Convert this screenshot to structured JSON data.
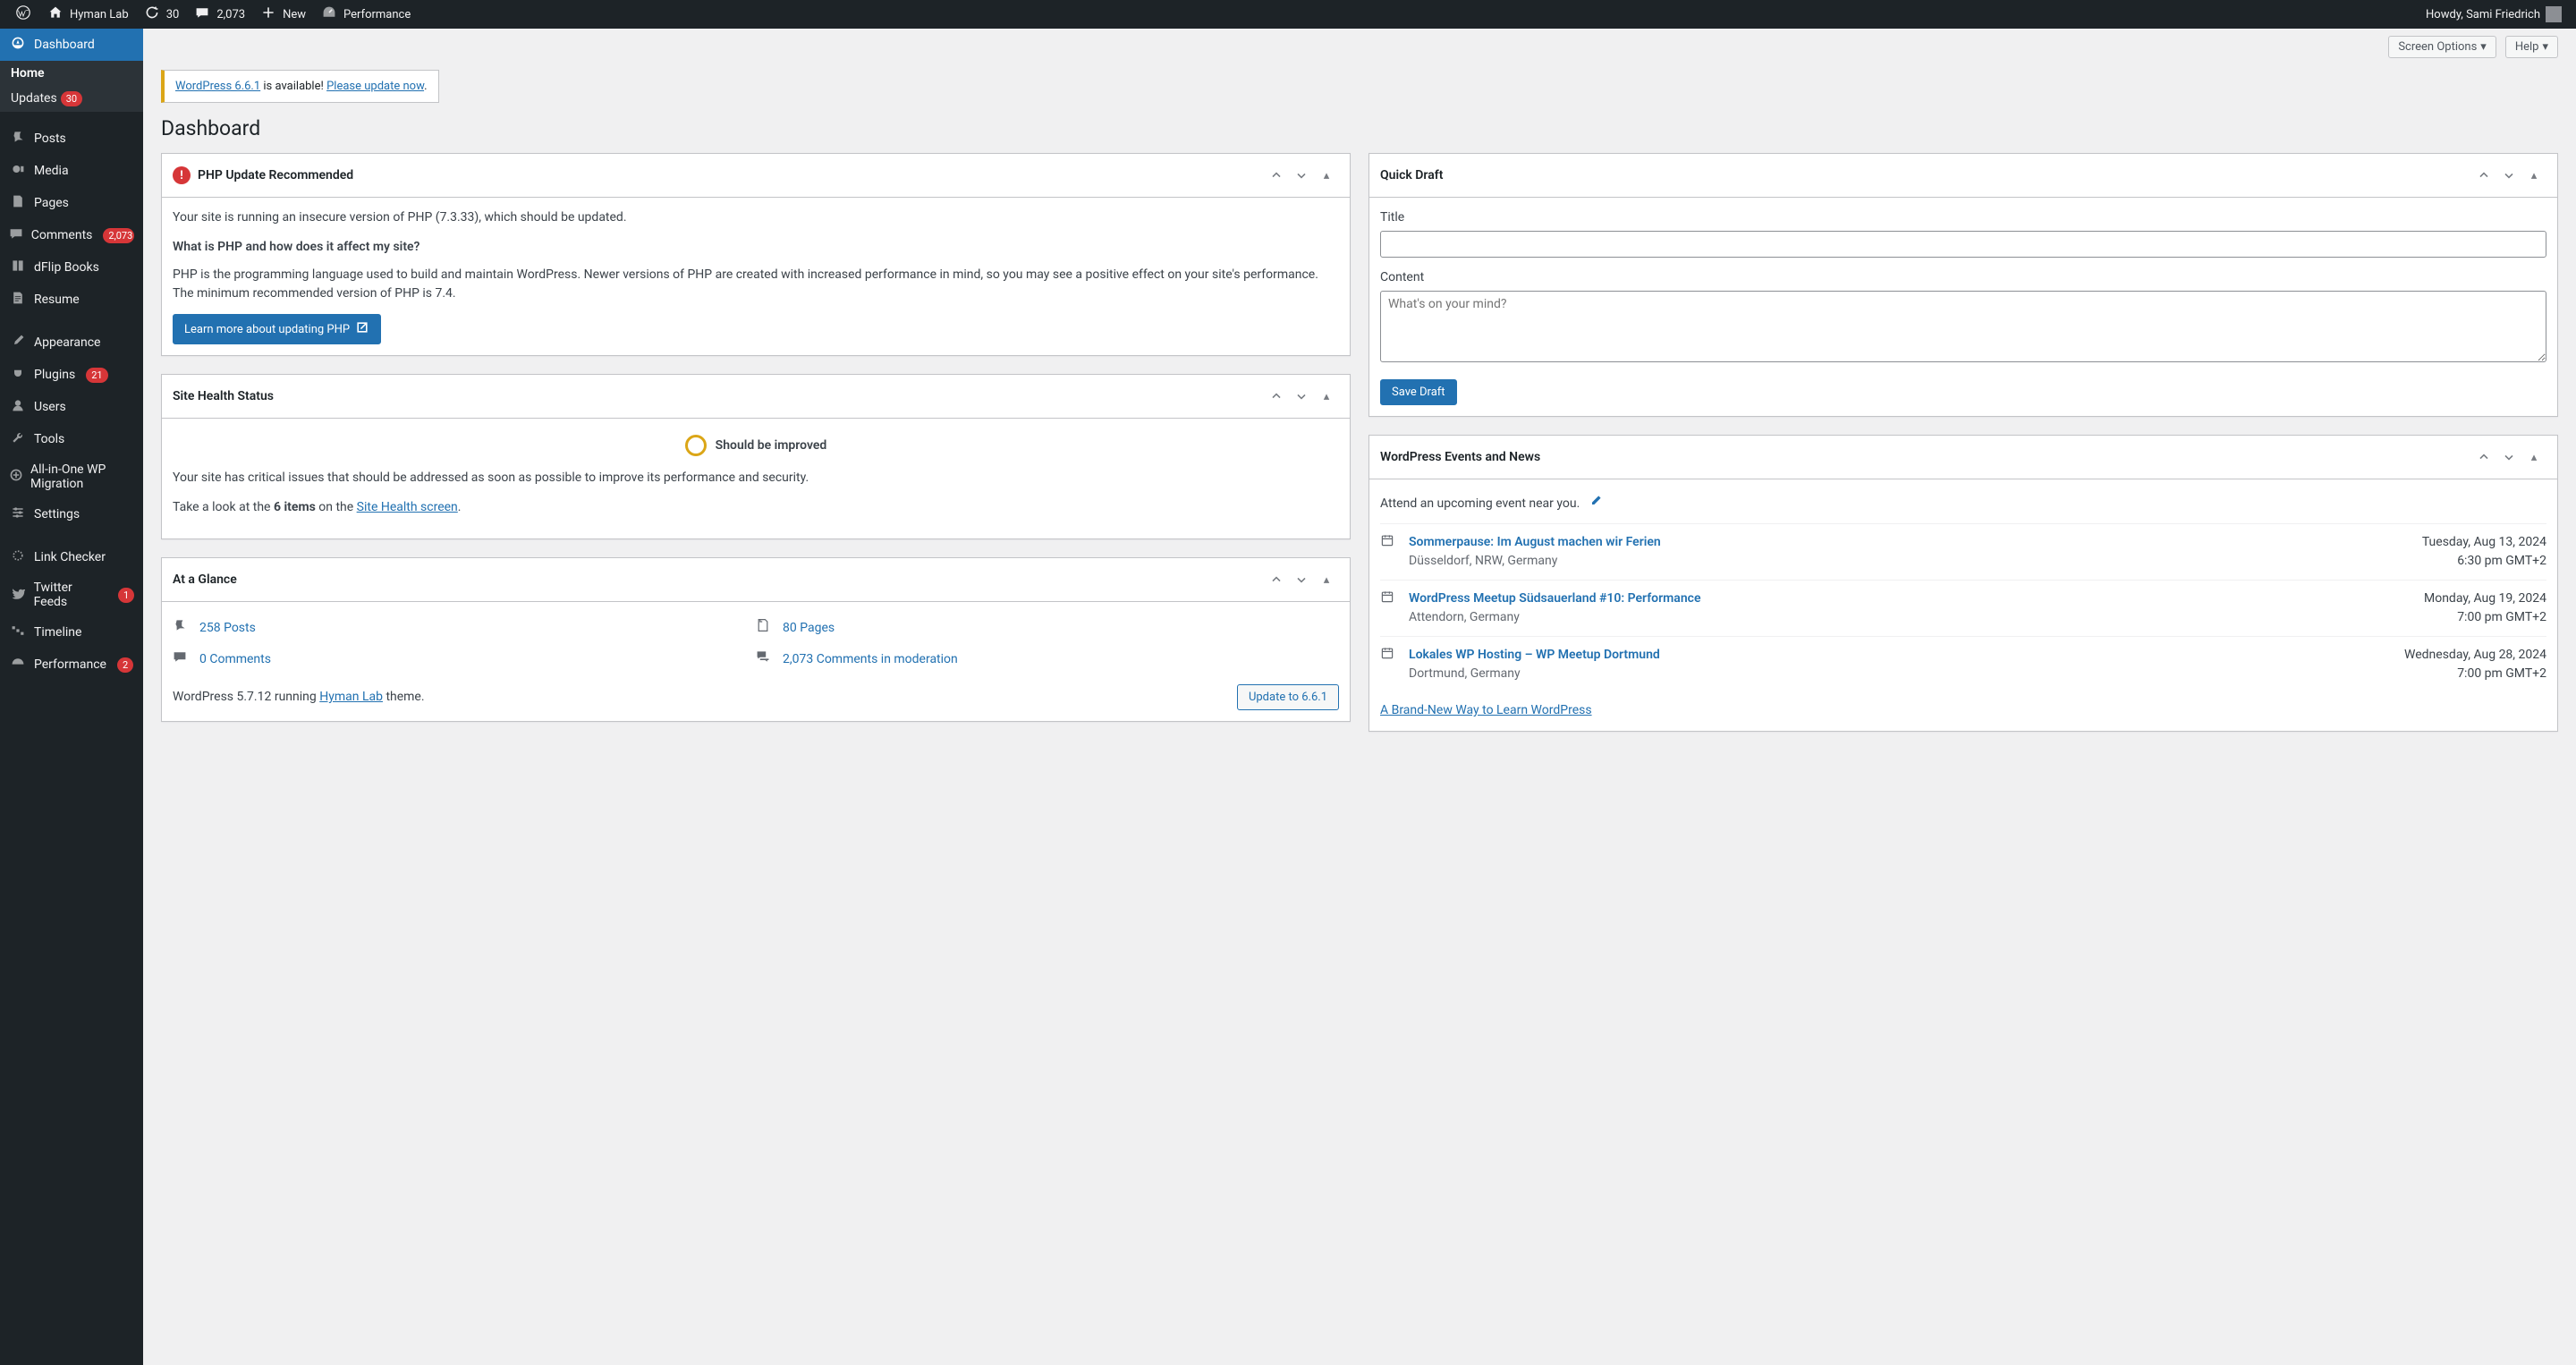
{
  "adminbar": {
    "site_name": "Hyman Lab",
    "updates_count": "30",
    "comments_count": "2,073",
    "new_label": "New",
    "performance_label": "Performance",
    "howdy_text": "Howdy, Sami Friedrich"
  },
  "sidebar": {
    "dashboard": "Dashboard",
    "home": "Home",
    "updates": "Updates",
    "updates_badge": "30",
    "posts": "Posts",
    "media": "Media",
    "pages": "Pages",
    "comments": "Comments",
    "comments_badge": "2,073",
    "dflip": "dFlip Books",
    "resume": "Resume",
    "appearance": "Appearance",
    "plugins": "Plugins",
    "plugins_badge": "21",
    "users": "Users",
    "tools": "Tools",
    "aio": "All-in-One WP Migration",
    "settings": "Settings",
    "linkchecker": "Link Checker",
    "twitter": "Twitter Feeds",
    "twitter_badge": "1",
    "timeline": "Timeline",
    "performance": "Performance",
    "performance_badge": "2"
  },
  "top": {
    "screen_options": "Screen Options",
    "help": "Help"
  },
  "notice": {
    "version_link": "WordPress 6.6.1",
    "available_text": " is available! ",
    "update_link": "Please update now",
    "period": "."
  },
  "page_title": "Dashboard",
  "php": {
    "title": "PHP Update Recommended",
    "p1": "Your site is running an insecure version of PHP (7.3.33), which should be updated.",
    "h": "What is PHP and how does it affect my site?",
    "p2": "PHP is the programming language used to build and maintain WordPress. Newer versions of PHP are created with increased performance in mind, so you may see a positive effect on your site's performance. The minimum recommended version of PHP is 7.4.",
    "button": "Learn more about updating PHP"
  },
  "health": {
    "title": "Site Health Status",
    "status": "Should be improved",
    "p_pre": "Your site has critical issues that should be addressed as soon as possible to improve its performance and security.",
    "look_pre": "Take a look at the ",
    "count": "6 items",
    "look_mid": " on the ",
    "link": "Site Health screen",
    "period": "."
  },
  "glance": {
    "title": "At a Glance",
    "posts": "258 Posts",
    "pages": "80 Pages",
    "comments0": "0 Comments",
    "moderation": "2,073 Comments in moderation",
    "wp_pre": "WordPress 5.7.12 running ",
    "theme": "Hyman Lab",
    "wp_post": " theme.",
    "update_btn": "Update to 6.6.1"
  },
  "quickdraft": {
    "title": "Quick Draft",
    "title_label": "Title",
    "content_label": "Content",
    "placeholder": "What's on your mind?",
    "save": "Save Draft"
  },
  "events": {
    "title": "WordPress Events and News",
    "intro": "Attend an upcoming event near you.",
    "items": [
      {
        "title": "Sommerpause: Im August machen wir Ferien",
        "loc": "Düsseldorf, NRW, Germany",
        "date": "Tuesday, Aug 13, 2024",
        "time": "6:30 pm GMT+2"
      },
      {
        "title": "WordPress Meetup Südsauerland #10: Performance",
        "loc": "Attendorn, Germany",
        "date": "Monday, Aug 19, 2024",
        "time": "7:00 pm GMT+2"
      },
      {
        "title": "Lokales WP Hosting – WP Meetup Dortmund",
        "loc": "Dortmund, Germany",
        "date": "Wednesday, Aug 28, 2024",
        "time": "7:00 pm GMT+2"
      }
    ],
    "news": "A Brand-New Way to Learn WordPress"
  }
}
